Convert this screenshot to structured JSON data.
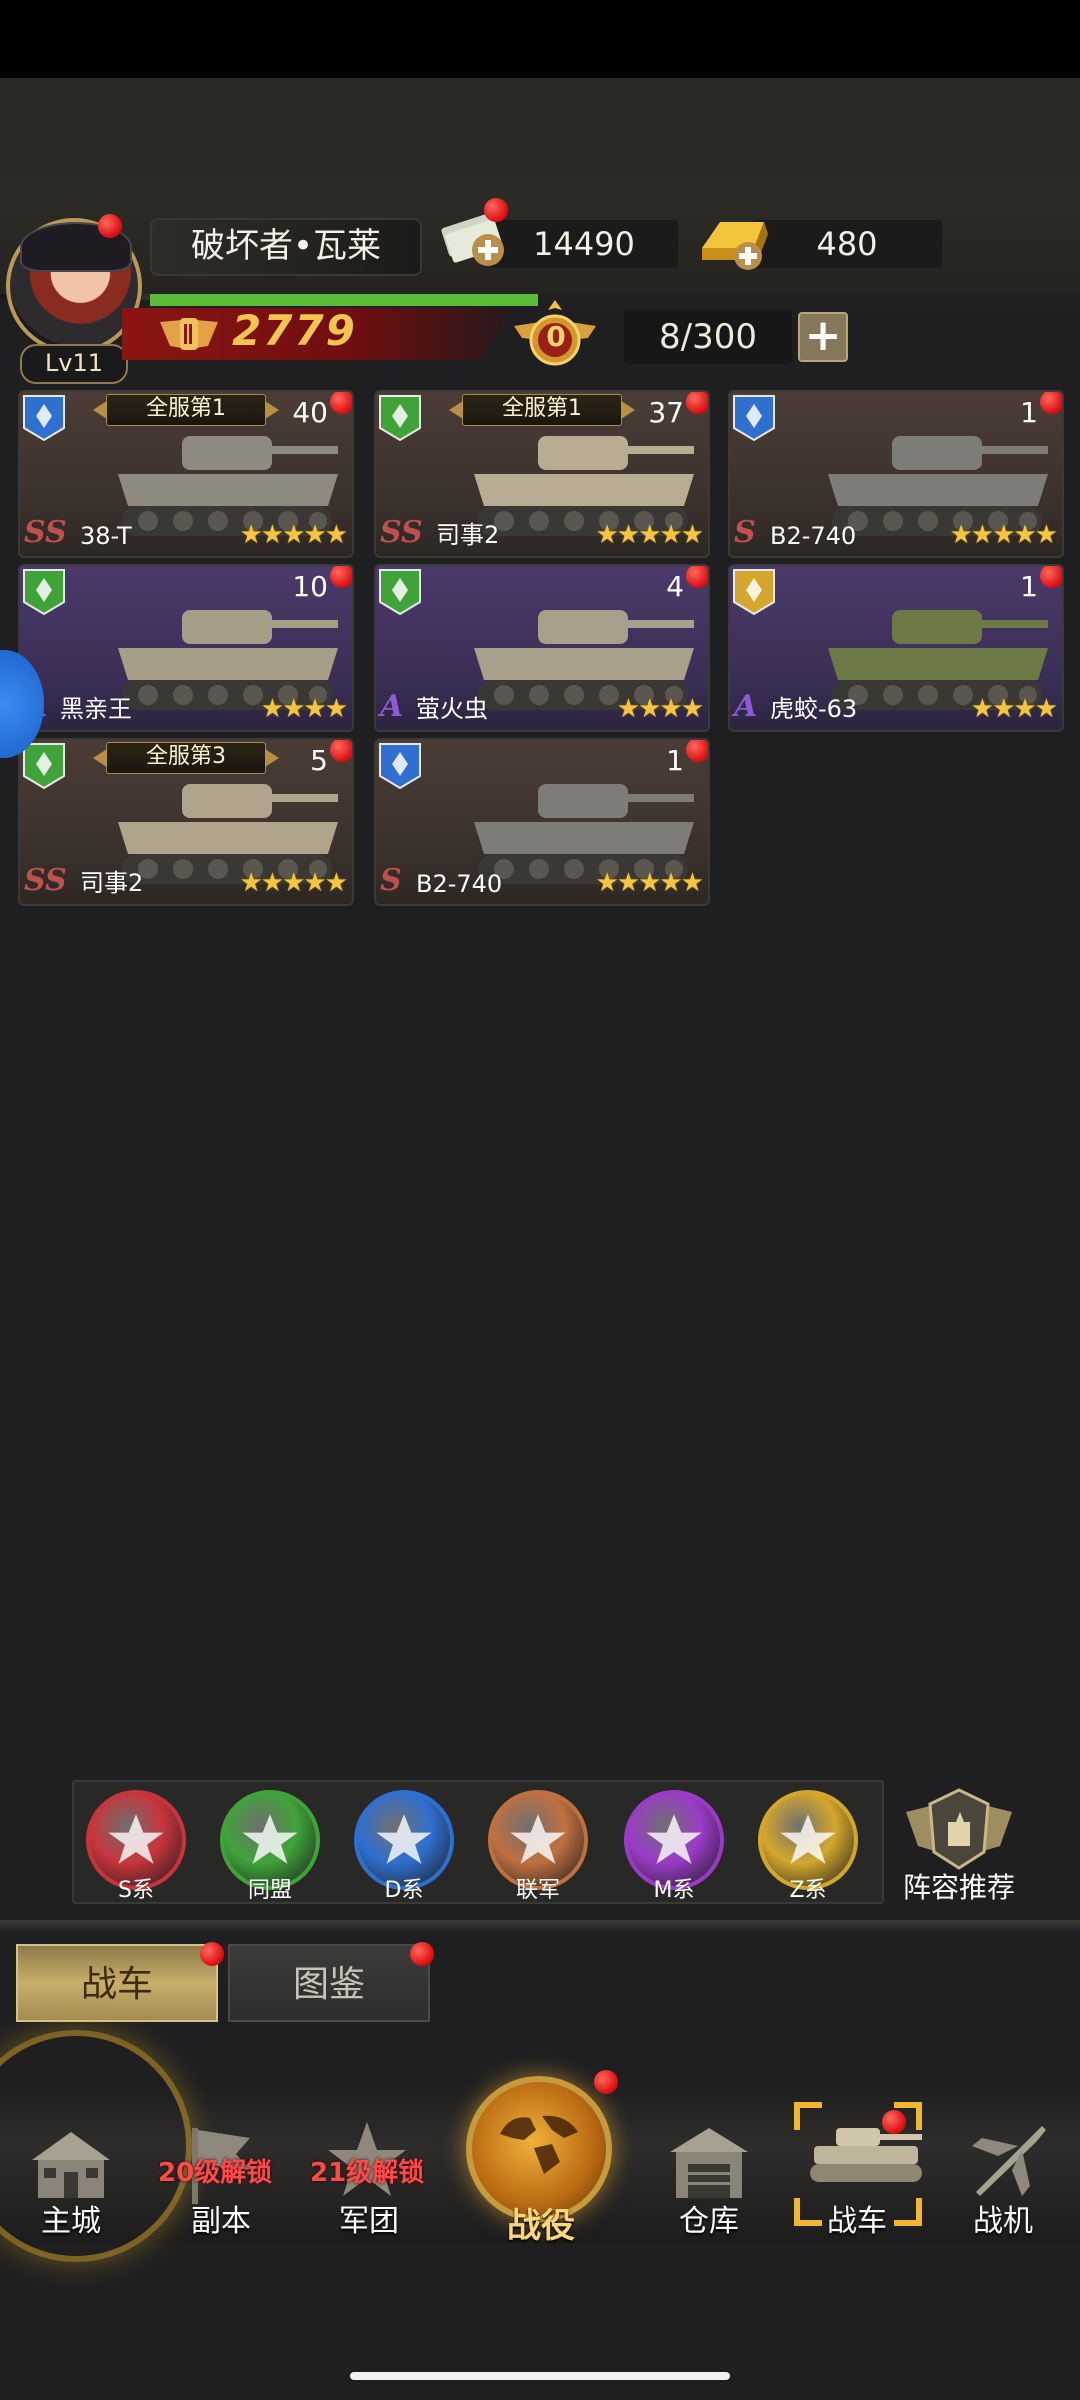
{
  "player": {
    "name": "破坏者•瓦莱",
    "level": "Lv11",
    "power": "2779",
    "rank_medal": "0"
  },
  "resources": {
    "cash": "14490",
    "gold": "480"
  },
  "garage": {
    "capacity": "8/300",
    "add_icon": "plus-icon"
  },
  "tanks": [
    {
      "name": "38-T",
      "grade": "SS",
      "count": "40",
      "stars": "★★★★★",
      "rank": "全服第1",
      "faction": "D系"
    },
    {
      "name": "司事2",
      "grade": "SS",
      "count": "37",
      "stars": "★★★★★",
      "rank": "全服第1",
      "faction": "同盟"
    },
    {
      "name": "B2-740",
      "grade": "S",
      "count": "1",
      "stars": "★★★★★",
      "rank": "",
      "faction": "D系"
    },
    {
      "name": "黑亲王",
      "grade": "A",
      "count": "10",
      "stars": "★★★★",
      "rank": "",
      "faction": "同盟"
    },
    {
      "name": "萤火虫",
      "grade": "A",
      "count": "4",
      "stars": "★★★★",
      "rank": "",
      "faction": "同盟"
    },
    {
      "name": "虎蛟-63",
      "grade": "A",
      "count": "1",
      "stars": "★★★★",
      "rank": "",
      "faction": "Z系"
    },
    {
      "name": "司事2",
      "grade": "SS",
      "count": "5",
      "stars": "★★★★★",
      "rank": "全服第3",
      "faction": "同盟"
    },
    {
      "name": "B2-740",
      "grade": "S",
      "count": "1",
      "stars": "★★★★★",
      "rank": "",
      "faction": "D系"
    }
  ],
  "factions": [
    {
      "label": "S系",
      "color": "#c8343c"
    },
    {
      "label": "同盟",
      "color": "#3fa33a"
    },
    {
      "label": "D系",
      "color": "#2f6fd0"
    },
    {
      "label": "联军",
      "color": "#c07040"
    },
    {
      "label": "M系",
      "color": "#9a3bc8"
    },
    {
      "label": "Z系",
      "color": "#d4a72c"
    }
  ],
  "recommend_label": "阵容推荐",
  "tabs": {
    "tanks": "战车",
    "codex": "图鉴"
  },
  "nav": {
    "main_city": "主城",
    "dungeon": "副本",
    "dungeon_lock": "20级解锁",
    "legion": "军团",
    "legion_lock": "21级解锁",
    "campaign": "战役",
    "warehouse": "仓库",
    "tank": "战车",
    "aircraft": "战机"
  },
  "colors": {
    "grade_ss": "#c0504d",
    "grade_s": "#c0504d",
    "grade_a": "#8e5bd6",
    "accent_gold": "#f3c44f"
  }
}
